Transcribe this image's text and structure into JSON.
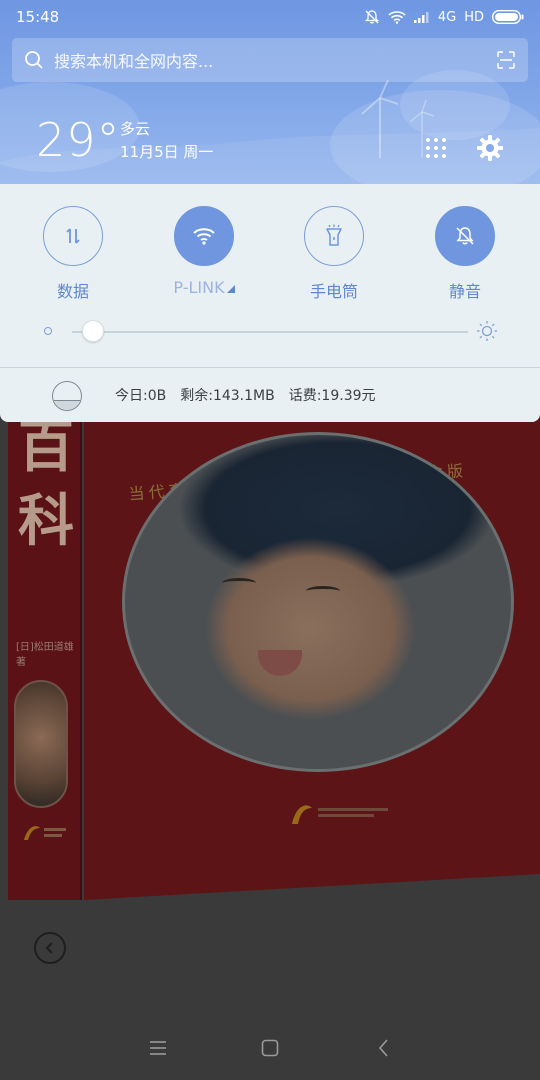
{
  "status_bar": {
    "time": "15:48",
    "network_type": "4G",
    "hd_label": "HD",
    "icons": [
      "mute-icon",
      "wifi-icon",
      "signal-icon",
      "battery-icon"
    ]
  },
  "search": {
    "placeholder": "搜索本机和全网内容..."
  },
  "weather": {
    "temperature": "29°",
    "condition": "多云",
    "date": "11月5日 周一"
  },
  "toggles": [
    {
      "label": "数据",
      "icon": "data-arrows-icon",
      "active": false
    },
    {
      "label": "P-LINK",
      "icon": "wifi-icon",
      "active": true
    },
    {
      "label": "手电筒",
      "icon": "flashlight-icon",
      "active": false
    },
    {
      "label": "静音",
      "icon": "mute-icon",
      "active": true
    }
  ],
  "brightness": {
    "level": 0.05
  },
  "data_usage": {
    "today": "今日:0B",
    "remaining": "剩余:143.1MB",
    "balance": "话费:19.39元"
  },
  "background_app": {
    "spine_title": "百科",
    "cover_subtitle": "当代育儿",
    "cover_subtitle_right": "十年纪念版",
    "spine_author": "[日]松田道雄 著"
  },
  "colors": {
    "accent": "#6f96de",
    "shade_panel": "#e9f0f3",
    "header_top": "#6f97e2"
  }
}
